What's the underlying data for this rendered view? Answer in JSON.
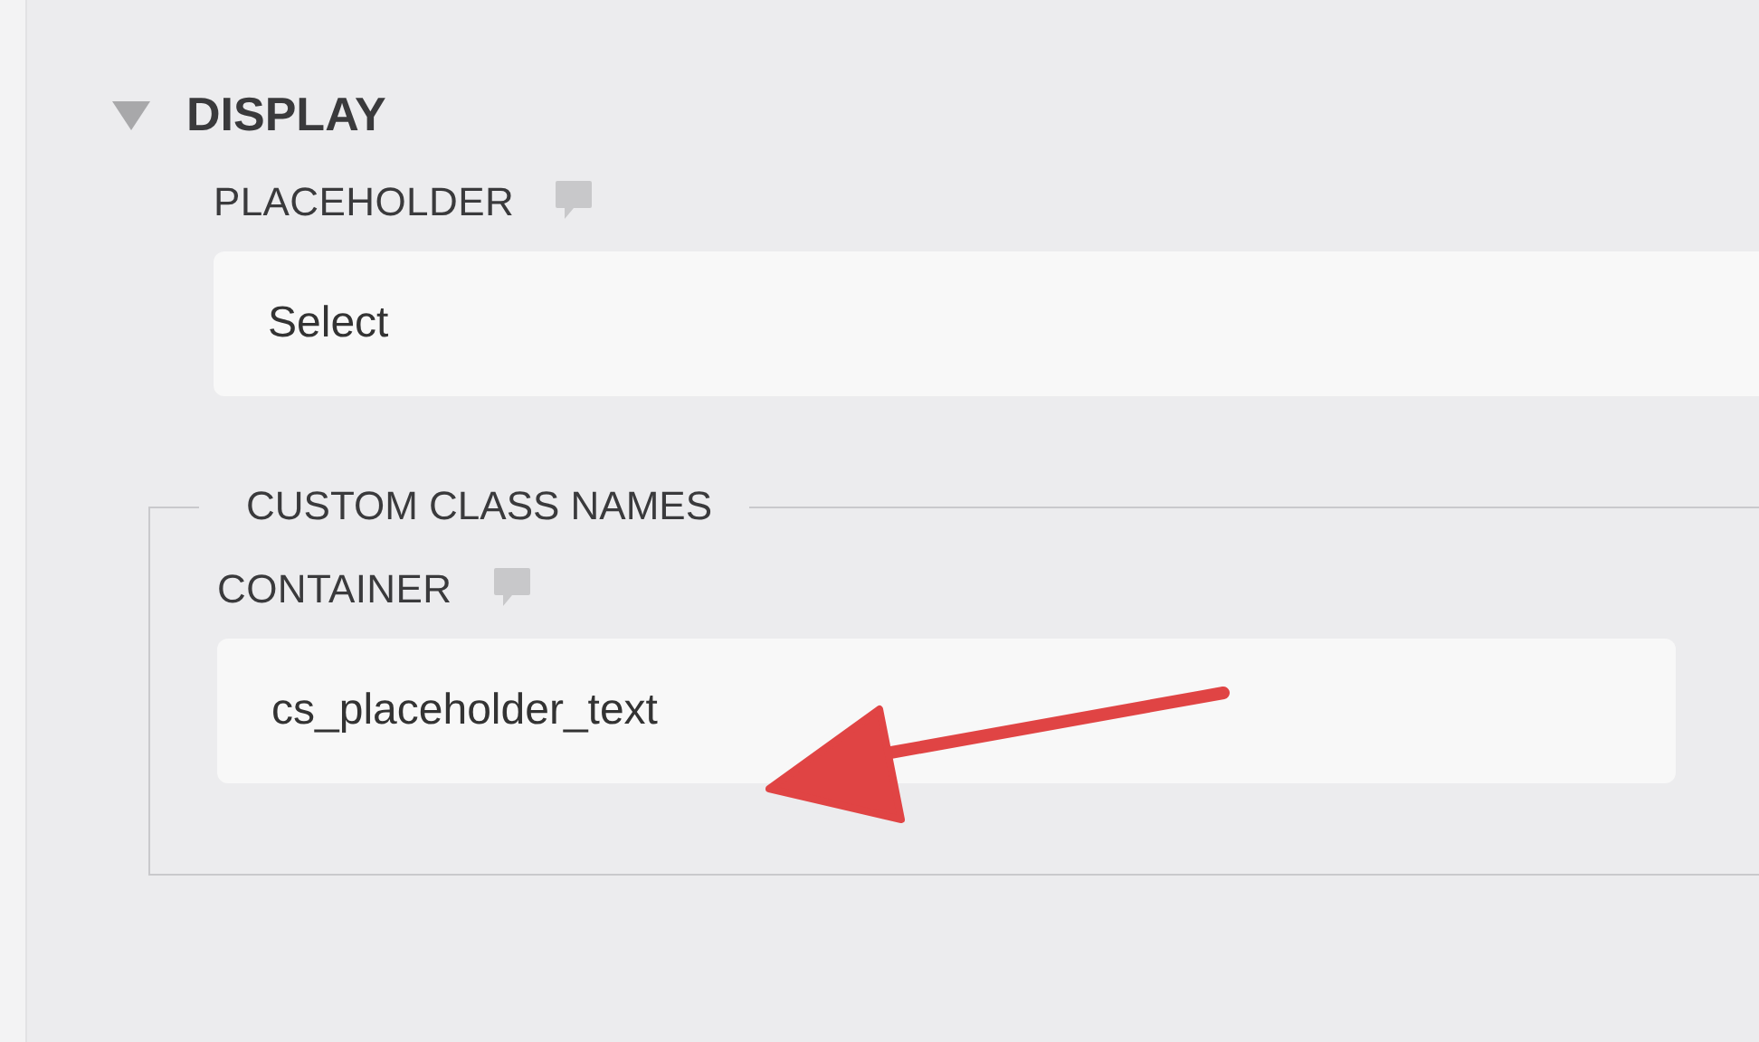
{
  "section": {
    "title": "DISPLAY",
    "expanded": true,
    "fields": [
      {
        "label": "PLACEHOLDER",
        "value": "Select"
      }
    ],
    "group": {
      "legend": "CUSTOM CLASS NAMES",
      "fields": [
        {
          "label": "CONTAINER",
          "value": "cs_placeholder_text"
        }
      ]
    }
  }
}
